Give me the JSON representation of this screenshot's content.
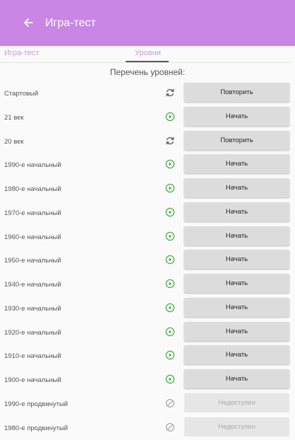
{
  "appbar": {
    "title": "Игра-тест",
    "color": "#ca86e4"
  },
  "tabs": [
    {
      "label": "Игра-тест",
      "selected": false
    },
    {
      "label": "Уровни",
      "selected": true
    }
  ],
  "list_header": "Перечень уровней:",
  "levels": [
    {
      "name": "Стартовый",
      "status": "repeat",
      "action": "Повторить",
      "icon": "refresh-icon"
    },
    {
      "name": "21 век",
      "status": "start",
      "action": "Начать",
      "icon": "play-icon"
    },
    {
      "name": "20 век",
      "status": "repeat",
      "action": "Повторить",
      "icon": "refresh-icon"
    },
    {
      "name": "1990-е начальный",
      "status": "start",
      "action": "Начать",
      "icon": "play-icon"
    },
    {
      "name": "1980-е начальный",
      "status": "start",
      "action": "Начать",
      "icon": "play-icon"
    },
    {
      "name": "1970-е начальный",
      "status": "start",
      "action": "Начать",
      "icon": "play-icon"
    },
    {
      "name": "1960-е начальный",
      "status": "start",
      "action": "Начать",
      "icon": "play-icon"
    },
    {
      "name": "1950-е начальный",
      "status": "start",
      "action": "Начать",
      "icon": "play-icon"
    },
    {
      "name": "1940-е начальный",
      "status": "start",
      "action": "Начать",
      "icon": "play-icon"
    },
    {
      "name": "1930-е начальный",
      "status": "start",
      "action": "Начать",
      "icon": "play-icon"
    },
    {
      "name": "1920-е начальный",
      "status": "start",
      "action": "Начать",
      "icon": "play-icon"
    },
    {
      "name": "1910-е начальный",
      "status": "start",
      "action": "Начать",
      "icon": "play-icon"
    },
    {
      "name": "1900-е начальный",
      "status": "start",
      "action": "Начать",
      "icon": "play-icon"
    },
    {
      "name": "1990-е продвинутый",
      "status": "locked",
      "action": "Недоступен",
      "icon": "blocked-icon"
    },
    {
      "name": "1980-е продвинутый",
      "status": "locked",
      "action": "Недоступен",
      "icon": "blocked-icon"
    }
  ],
  "colors": {
    "play": "#43b04a",
    "refresh": "#5a5a5a",
    "blocked": "#a8a8a8"
  }
}
